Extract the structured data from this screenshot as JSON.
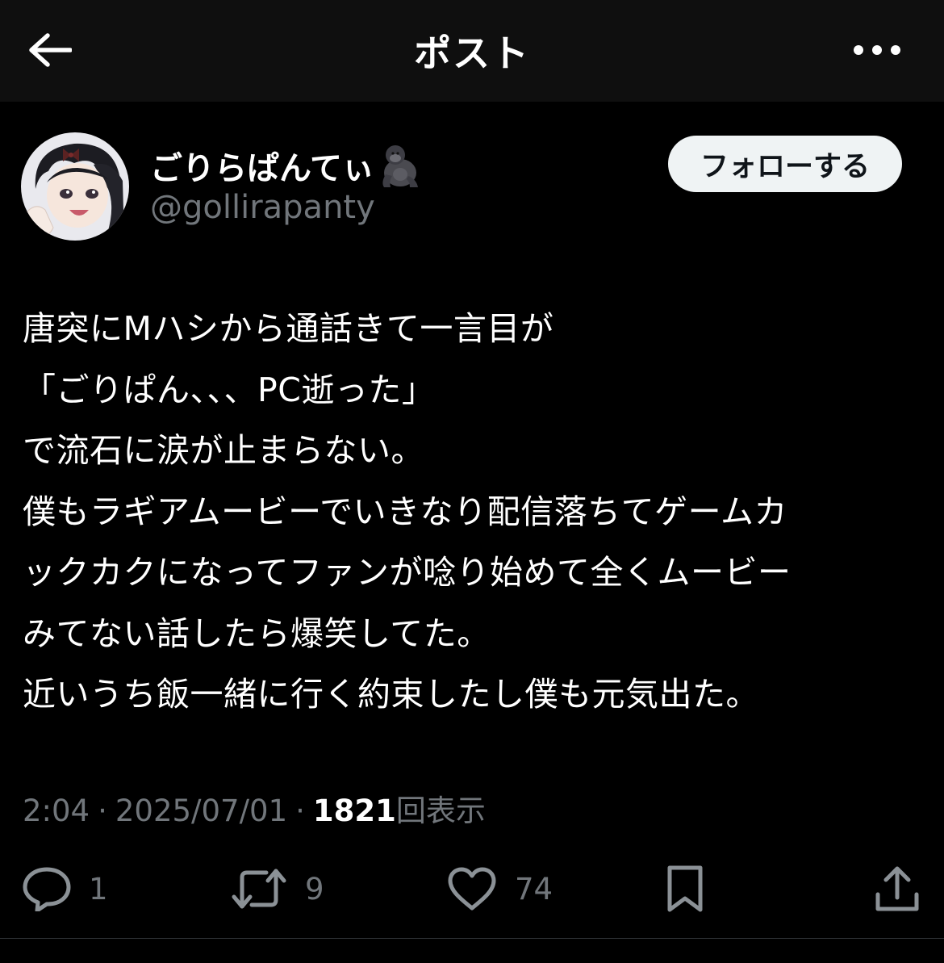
{
  "header": {
    "title": "ポスト"
  },
  "author": {
    "display_name": "ごりらぱんてぃ",
    "handle": "@gollirapanty",
    "follow_label": "フォローする"
  },
  "tweet": {
    "lines": [
      "唐突にMハシから通話きて一言目が",
      "「ごりぱん、、、PC逝った」",
      "で流石に涙が止まらない。",
      "僕もラギアムービーでいきなり配信落ちてゲームカ",
      "ックカクになってファンが唸り始めて全くムービー",
      "みてない話したら爆笑してた。",
      "近いうち飯一緒に行く約束したし僕も元気出た。"
    ]
  },
  "meta": {
    "time": "2:04",
    "date": "2025/07/01",
    "views_count": "1821",
    "views_label": "回表示",
    "separator": "·"
  },
  "actions": {
    "replies": "1",
    "reposts": "9",
    "likes": "74"
  },
  "colors": {
    "background": "#000000",
    "header_bg": "#0f0f0f",
    "text_primary": "#ffffff",
    "text_secondary": "#71767b",
    "follow_bg": "#eff3f4"
  }
}
